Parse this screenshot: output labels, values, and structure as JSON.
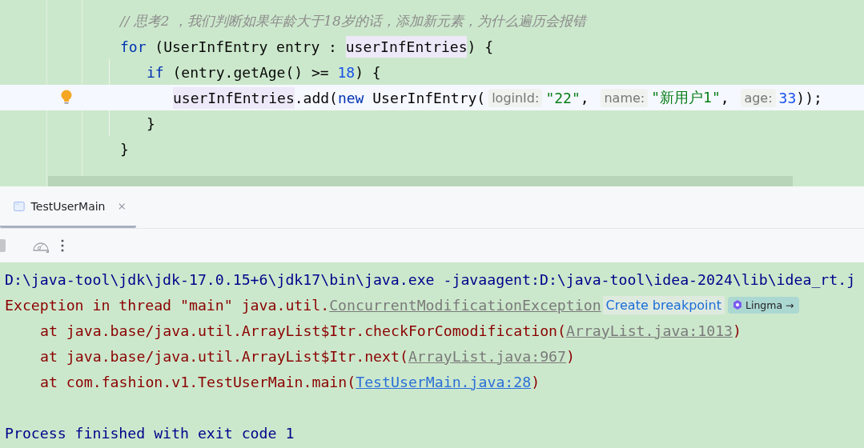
{
  "editor": {
    "lines": [
      {
        "tokens": [
          {
            "kind": "comment",
            "text": "// 思考2 ，我们判断如果年龄大于18岁的话，添加新元素，为什么遍历会报错"
          }
        ]
      },
      {
        "tokens": [
          {
            "kind": "keyword",
            "text": "for"
          },
          {
            "kind": "plain",
            "text": " (UserInfEntry entry : "
          },
          {
            "kind": "highlight",
            "text": "userInfEntries"
          },
          {
            "kind": "plain",
            "text": ") {"
          }
        ],
        "children": [
          {
            "tokens": [
              {
                "kind": "keyword",
                "text": "if"
              },
              {
                "kind": "plain",
                "text": " (entry.getAge() >= "
              },
              {
                "kind": "number",
                "text": "18"
              },
              {
                "kind": "plain",
                "text": ") {"
              }
            ],
            "children": [
              {
                "current": true,
                "tokens": [
                  {
                    "kind": "highlight",
                    "text": "userInfEntries"
                  },
                  {
                    "kind": "plain",
                    "text": ".add("
                  },
                  {
                    "kind": "keyword",
                    "text": "new"
                  },
                  {
                    "kind": "plain",
                    "text": " UserInfEntry("
                  },
                  {
                    "kind": "hint",
                    "text": "loginId:"
                  },
                  {
                    "kind": "string",
                    "text": "\"22\""
                  },
                  {
                    "kind": "plain",
                    "text": ", "
                  },
                  {
                    "kind": "hint",
                    "text": "name:"
                  },
                  {
                    "kind": "string",
                    "text": "\"新用户1\""
                  },
                  {
                    "kind": "plain",
                    "text": ", "
                  },
                  {
                    "kind": "hint",
                    "text": "age:"
                  },
                  {
                    "kind": "number",
                    "text": "33"
                  },
                  {
                    "kind": "plain",
                    "text": "));"
                  }
                ]
              }
            ]
          },
          {
            "tokens": [
              {
                "kind": "plain",
                "text": "}"
              }
            ]
          }
        ]
      },
      {
        "tokens": [
          {
            "kind": "plain",
            "text": "}"
          }
        ]
      }
    ]
  },
  "tabs": [
    {
      "label": "TestUserMain",
      "selected": true
    }
  ],
  "console": {
    "lines": [
      {
        "kind": "command",
        "segments": [
          {
            "kind": "text",
            "text": "D:\\java-tool\\jdk\\jdk-17.0.15+6\\jdk17\\bin\\java.exe -javaagent:D:\\java-tool\\idea-2024\\lib\\idea_rt.j"
          }
        ]
      },
      {
        "kind": "error",
        "segments": [
          {
            "kind": "text",
            "text": "Exception in thread \"main\" java.util."
          },
          {
            "kind": "link",
            "text": "ConcurrentModificationException"
          },
          {
            "kind": "chip",
            "text": "Create breakpoint"
          },
          {
            "kind": "ai",
            "text": "Lingma →"
          }
        ]
      },
      {
        "kind": "stack",
        "segments": [
          {
            "kind": "text",
            "text": "at java.base/java.util.ArrayList$Itr.checkForComodification("
          },
          {
            "kind": "link",
            "text": "ArrayList.java:1013"
          },
          {
            "kind": "text",
            "text": ")"
          }
        ]
      },
      {
        "kind": "stack",
        "segments": [
          {
            "kind": "text",
            "text": "at java.base/java.util.ArrayList$Itr.next("
          },
          {
            "kind": "link",
            "text": "ArrayList.java:967"
          },
          {
            "kind": "text",
            "text": ")"
          }
        ]
      },
      {
        "kind": "stack",
        "segments": [
          {
            "kind": "text",
            "text": "at com.fashion.v1.TestUserMain.main("
          },
          {
            "kind": "hyperlink",
            "text": "TestUserMain.java:28"
          },
          {
            "kind": "text",
            "text": ")"
          }
        ]
      },
      {
        "kind": "exit",
        "segments": [
          {
            "kind": "text",
            "text": "Process finished with exit code 1"
          }
        ]
      }
    ]
  }
}
